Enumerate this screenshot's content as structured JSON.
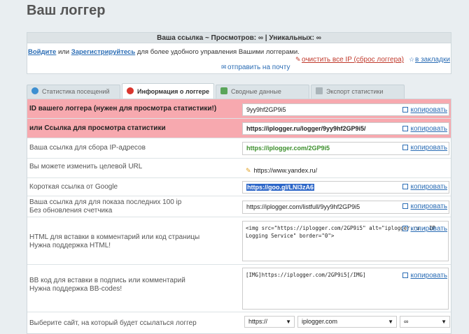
{
  "page": {
    "title": "Ваш логгер"
  },
  "info": {
    "header": "Ваша ссылка ~ Просмотров: ∞ | Уникальных: ∞",
    "login_link": "Войдите",
    "or": " или ",
    "register_link": "Зарегистрируйтесь",
    "login_suffix": " для более удобного управления Вашими логгерами.",
    "clear_ip": "очистить все IP (сброс логгера)",
    "bookmarks": "в закладки",
    "send_mail": "отправить на почту"
  },
  "tabs": [
    {
      "label": "Статистика посещений",
      "icon": "chart-icon"
    },
    {
      "label": "Информация о логгере",
      "icon": "question-icon"
    },
    {
      "label": "Сводные данные",
      "icon": "pie-icon"
    },
    {
      "label": "Экспорт статистики",
      "icon": "table-icon"
    }
  ],
  "rows": {
    "logger_id": {
      "label": "ID вашего логгера (нужен для просмотра статистики!)",
      "value": "9yy9hf2GP9i5",
      "copy": "копировать"
    },
    "view_link": {
      "label": "или Ссылка для просмотра статистики",
      "value": "https://iplogger.ru/logger/9yy9hf2GP9i5/",
      "copy": "копировать"
    },
    "collect_link": {
      "label": "Ваша ссылка для сбора IP-адресов",
      "value": "https://iplogger.com/2GP9i5",
      "copy": "копировать"
    },
    "target_url": {
      "label": "Вы можете изменить целевой URL",
      "value": "https://www.yandex.ru/"
    },
    "google_short": {
      "label": "Короткая ссылка от Google",
      "value": "https://goo.gl/LNl3zA6",
      "copy": "копировать"
    },
    "last100": {
      "label_1": "Ваша ссылка для для показа последних 100 ip",
      "label_2": "Без обновления счетчика",
      "value": "https://iplogger.com/listfull/9yy9hf2GP9i5",
      "copy": "копировать"
    },
    "html_code": {
      "label_1": "HTML для вставки в комментарий или код страницы",
      "label_2": "Нужна поддержка HTML!",
      "value": "<img src=\"https://iplogger.com/2GP9i5\" alt=\"iplogger.ru - IP Logging Service\" border=\"0\">",
      "copy": "копировать"
    },
    "bb_code": {
      "label_1": "BB код для вставки в подпись или комментарий",
      "label_2": "Нужна поддержка BB-codes!",
      "value": "[IMG]https://iplogger.com/2GP9i5[/IMG]",
      "copy": "копировать"
    },
    "site_select": {
      "label": "Выберите сайт, на который будет ссылаться логгер",
      "protocol": "https://",
      "domain": "iplogger.com",
      "suffix": "∞"
    }
  },
  "colors": {
    "accent": "#2b6db5",
    "highlight": "#f7a9af",
    "green": "#3c8f2c",
    "danger": "#c0392b"
  }
}
